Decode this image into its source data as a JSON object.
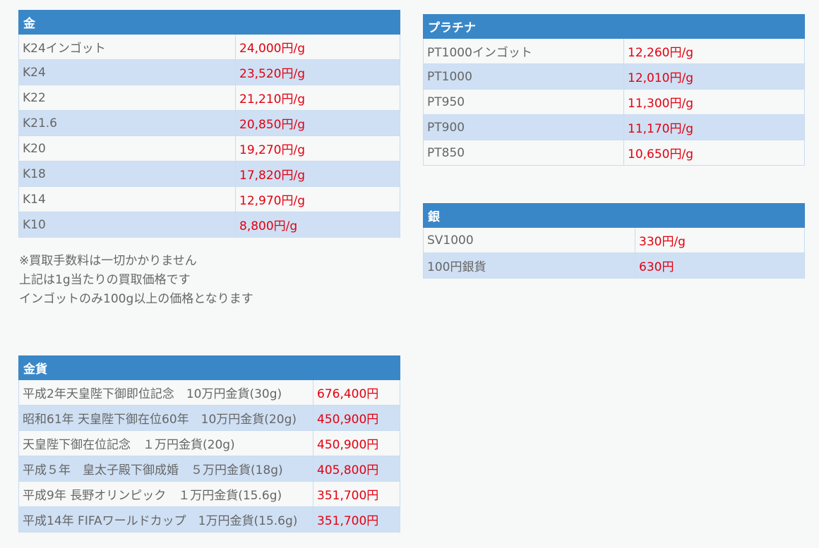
{
  "gold": {
    "title": "金",
    "rows": [
      {
        "name": "K24インゴット",
        "price": "24,000円/g"
      },
      {
        "name": "K24",
        "price": "23,520円/g"
      },
      {
        "name": "K22",
        "price": "21,210円/g"
      },
      {
        "name": "K21.6",
        "price": "20,850円/g"
      },
      {
        "name": "K20",
        "price": "19,270円/g"
      },
      {
        "name": "K18",
        "price": "17,820円/g"
      },
      {
        "name": "K14",
        "price": "12,970円/g"
      },
      {
        "name": "K10",
        "price": "8,800円/g"
      }
    ]
  },
  "notes": [
    "※買取手数料は一切かかりません",
    "上記は1g当たりの買取価格です",
    "インゴットのみ100g以上の価格となります"
  ],
  "platinum": {
    "title": "プラチナ",
    "rows": [
      {
        "name": "PT1000インゴット",
        "price": "12,260円/g"
      },
      {
        "name": "PT1000",
        "price": "12,010円/g"
      },
      {
        "name": "PT950",
        "price": "11,300円/g"
      },
      {
        "name": "PT900",
        "price": "11,170円/g"
      },
      {
        "name": "PT850",
        "price": "10,650円/g"
      }
    ]
  },
  "silver": {
    "title": "銀",
    "rows": [
      {
        "name": "SV1000",
        "price": "330円/g"
      },
      {
        "name": "100円銀貨",
        "price": "630円"
      }
    ]
  },
  "gold_coins": {
    "title": "金貨",
    "rows": [
      {
        "name": "平成2年天皇陛下御即位記念　10万円金貨(30g)",
        "price": "676,400円"
      },
      {
        "name": "昭和61年 天皇陛下御在位60年　10万円金貨(20g)",
        "price": "450,900円"
      },
      {
        "name": "天皇陛下御在位記念　１万円金貨(20g)",
        "price": "450,900円"
      },
      {
        "name": "平成５年　皇太子殿下御成婚　５万円金貨(18g)",
        "price": "405,800円"
      },
      {
        "name": "平成9年 長野オリンピック　１万円金貨(15.6g)",
        "price": "351,700円"
      },
      {
        "name": "平成14年 FIFAワールドカップ　1万円金貨(15.6g)",
        "price": "351,700円"
      }
    ]
  },
  "colors": {
    "header_bg": "#3a87c8",
    "row_alt_bg": "#cfe0f4",
    "price_text": "#e3000f"
  }
}
